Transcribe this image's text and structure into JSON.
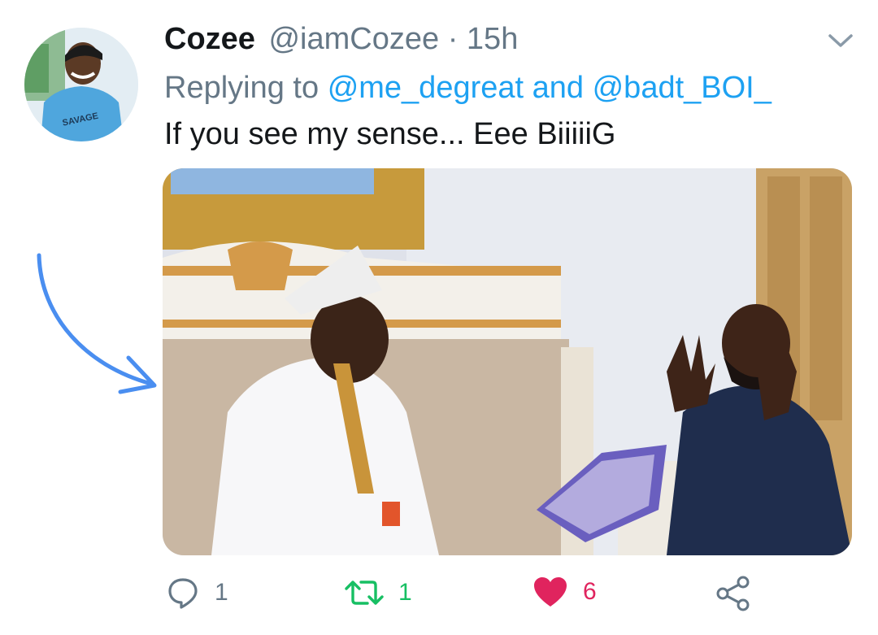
{
  "tweet": {
    "author_name": "Cozee",
    "author_handle": "@iamCozee",
    "separator": "·",
    "time_ago": "15h",
    "replying_prefix": "Replying to",
    "reply_mention_1": "@me_degreat",
    "reply_and": "and",
    "reply_mention_2": "@badt_BOI_",
    "text": "If you see my sense... Eee BiiiiiG"
  },
  "avatar": {
    "shirt_text": "SAVAGE"
  },
  "actions": {
    "reply_count": "1",
    "retweet_count": "1",
    "like_count": "6"
  },
  "icons": {
    "menu": "chevron-down-icon",
    "reply": "reply-bubble-icon",
    "retweet": "retweet-icon",
    "like": "heart-icon",
    "share": "share-icon"
  },
  "colors": {
    "name": "#14171a",
    "meta": "#657786",
    "mention": "#1da1f2",
    "retweet": "#17bf63",
    "like": "#e0245e",
    "annotation_arrow": "#4a8ef0"
  }
}
